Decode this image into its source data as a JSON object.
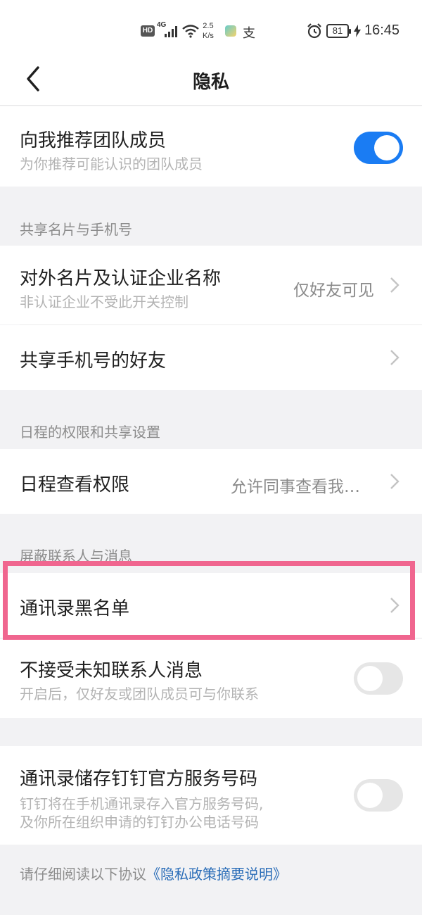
{
  "status_bar": {
    "hd": "HD",
    "network": "4G",
    "speed_top": "2.5",
    "speed_bottom": "K/s",
    "app_icon2": "支",
    "battery": "81",
    "time": "16:45"
  },
  "nav": {
    "title": "隐私"
  },
  "recommend": {
    "title": "向我推荐团队成员",
    "subtitle": "为你推荐可能认识的团队成员",
    "enabled": true
  },
  "group_card": {
    "label": "共享名片与手机号",
    "items": [
      {
        "title": "对外名片及认证企业名称",
        "subtitle": "非认证企业不受此开关控制",
        "value": "仅好友可见"
      },
      {
        "title": "共享手机号的好友"
      }
    ]
  },
  "group_schedule": {
    "label": "日程的权限和共享设置",
    "items": [
      {
        "title": "日程查看权限",
        "value": "允许同事查看我…"
      }
    ]
  },
  "group_block": {
    "label": "屏蔽联系人与消息",
    "items": [
      {
        "title": "通讯录黑名单"
      },
      {
        "title": "不接受未知联系人消息",
        "subtitle": "开启后，仅好友或团队成员可与你联系",
        "enabled": false
      }
    ]
  },
  "contacts_store": {
    "title": "通讯录储存钉钉官方服务号码",
    "subtitle_line1": "钉钉将在手机通讯录存入官方服务号码,",
    "subtitle_line2": "及你所在组织申请的钉钉办公电话号码",
    "enabled": false
  },
  "footer": {
    "text": "请仔细阅读以下协议",
    "link": "《隐私政策摘要说明》"
  },
  "colors": {
    "accent": "#1a7cf3",
    "highlight": "#f0668f",
    "link": "#2a6db8"
  }
}
